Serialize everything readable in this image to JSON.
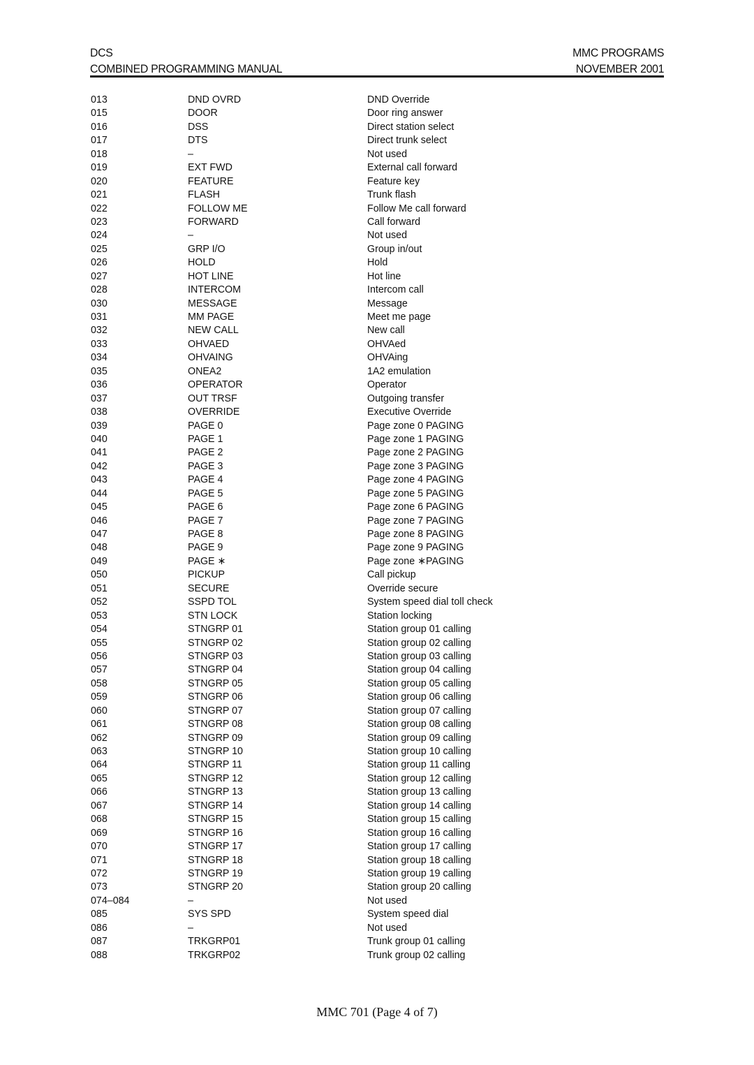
{
  "header": {
    "left_line1": "DCS",
    "left_line2": "COMBINED PROGRAMMING MANUAL",
    "right_line1": "MMC PROGRAMS",
    "right_line2": "NOVEMBER 2001"
  },
  "table": {
    "rows": [
      {
        "code": "013",
        "key": "DND OVRD",
        "desc": "DND Override"
      },
      {
        "code": "015",
        "key": "DOOR",
        "desc": "Door ring answer"
      },
      {
        "code": "016",
        "key": "DSS",
        "desc": "Direct station select"
      },
      {
        "code": "017",
        "key": "DTS",
        "desc": "Direct trunk select"
      },
      {
        "code": "018",
        "key": "–",
        "desc": "Not used"
      },
      {
        "code": "019",
        "key": "EXT FWD",
        "desc": "External call forward"
      },
      {
        "code": "020",
        "key": "FEATURE",
        "desc": "Feature key"
      },
      {
        "code": "021",
        "key": "FLASH",
        "desc": "Trunk flash"
      },
      {
        "code": "022",
        "key": "FOLLOW ME",
        "desc": "Follow Me call forward"
      },
      {
        "code": "023",
        "key": "FORWARD",
        "desc": "Call forward"
      },
      {
        "code": "024",
        "key": "–",
        "desc": "Not used"
      },
      {
        "code": "025",
        "key": "GRP I/O",
        "desc": "Group in/out"
      },
      {
        "code": "026",
        "key": "HOLD",
        "desc": "Hold"
      },
      {
        "code": "027",
        "key": "HOT LINE",
        "desc": "Hot line"
      },
      {
        "code": "028",
        "key": "INTERCOM",
        "desc": "Intercom call"
      },
      {
        "code": "030",
        "key": "MESSAGE",
        "desc": "Message"
      },
      {
        "code": "031",
        "key": "MM PAGE",
        "desc": "Meet me page"
      },
      {
        "code": "032",
        "key": "NEW CALL",
        "desc": "New call"
      },
      {
        "code": "033",
        "key": "OHVAED",
        "desc": "OHVAed"
      },
      {
        "code": "034",
        "key": "OHVAING",
        "desc": "OHVAing"
      },
      {
        "code": "035",
        "key": "ONEA2",
        "desc": "1A2 emulation"
      },
      {
        "code": "036",
        "key": "OPERATOR",
        "desc": "Operator"
      },
      {
        "code": "037",
        "key": "OUT TRSF",
        "desc": "Outgoing transfer"
      },
      {
        "code": "038",
        "key": "OVERRIDE",
        "desc": "Executive Override"
      },
      {
        "code": "039",
        "key": "PAGE 0",
        "desc": "Page zone 0 PAGING"
      },
      {
        "code": "040",
        "key": "PAGE 1",
        "desc": "Page zone 1 PAGING"
      },
      {
        "code": "041",
        "key": "PAGE 2",
        "desc": "Page zone 2 PAGING"
      },
      {
        "code": "042",
        "key": "PAGE 3",
        "desc": "Page zone 3 PAGING"
      },
      {
        "code": "043",
        "key": "PAGE 4",
        "desc": "Page zone 4 PAGING"
      },
      {
        "code": "044",
        "key": "PAGE 5",
        "desc": "Page zone 5 PAGING"
      },
      {
        "code": "045",
        "key": "PAGE 6",
        "desc": "Page zone 6 PAGING"
      },
      {
        "code": "046",
        "key": "PAGE 7",
        "desc": "Page zone 7 PAGING"
      },
      {
        "code": "047",
        "key": "PAGE 8",
        "desc": "Page zone 8 PAGING"
      },
      {
        "code": "048",
        "key": "PAGE 9",
        "desc": "Page zone 9 PAGING"
      },
      {
        "code": "049",
        "key": "PAGE ∗",
        "desc": "Page zone ∗PAGING"
      },
      {
        "code": "050",
        "key": "PICKUP",
        "desc": "Call pickup"
      },
      {
        "code": "051",
        "key": "SECURE",
        "desc": "Override secure"
      },
      {
        "code": "052",
        "key": "SSPD TOL",
        "desc": "System speed dial toll check"
      },
      {
        "code": "053",
        "key": "STN LOCK",
        "desc": "Station locking"
      },
      {
        "code": "054",
        "key": "STNGRP 01",
        "desc": "Station group 01 calling"
      },
      {
        "code": "055",
        "key": "STNGRP 02",
        "desc": "Station group 02 calling"
      },
      {
        "code": "056",
        "key": "STNGRP 03",
        "desc": "Station group 03 calling"
      },
      {
        "code": "057",
        "key": "STNGRP 04",
        "desc": "Station group 04 calling"
      },
      {
        "code": "058",
        "key": "STNGRP 05",
        "desc": "Station group 05 calling"
      },
      {
        "code": "059",
        "key": "STNGRP 06",
        "desc": "Station group 06 calling"
      },
      {
        "code": "060",
        "key": "STNGRP 07",
        "desc": "Station group 07 calling"
      },
      {
        "code": "061",
        "key": "STNGRP 08",
        "desc": "Station group 08 calling"
      },
      {
        "code": "062",
        "key": "STNGRP 09",
        "desc": "Station group 09 calling"
      },
      {
        "code": "063",
        "key": "STNGRP 10",
        "desc": "Station group 10 calling"
      },
      {
        "code": "064",
        "key": "STNGRP 11",
        "desc": "Station group 11 calling"
      },
      {
        "code": "065",
        "key": "STNGRP 12",
        "desc": "Station group 12 calling"
      },
      {
        "code": "066",
        "key": "STNGRP 13",
        "desc": "Station group 13 calling"
      },
      {
        "code": "067",
        "key": "STNGRP 14",
        "desc": "Station group 14 calling"
      },
      {
        "code": "068",
        "key": "STNGRP 15",
        "desc": "Station group 15 calling"
      },
      {
        "code": "069",
        "key": "STNGRP 16",
        "desc": "Station group 16 calling"
      },
      {
        "code": "070",
        "key": "STNGRP 17",
        "desc": "Station group 17 calling"
      },
      {
        "code": "071",
        "key": "STNGRP 18",
        "desc": "Station group 18 calling"
      },
      {
        "code": "072",
        "key": "STNGRP 19",
        "desc": "Station group 19 calling"
      },
      {
        "code": "073",
        "key": "STNGRP 20",
        "desc": "Station group 20 calling"
      },
      {
        "code": "074–084",
        "key": "–",
        "desc": "Not used"
      },
      {
        "code": "085",
        "key": "SYS SPD",
        "desc": "System speed dial"
      },
      {
        "code": "086",
        "key": "–",
        "desc": "Not used"
      },
      {
        "code": "087",
        "key": "TRKGRP01",
        "desc": "Trunk group 01 calling"
      },
      {
        "code": "088",
        "key": "TRKGRP02",
        "desc": "Trunk group 02 calling"
      }
    ]
  },
  "footer": {
    "page_label": "MMC 701 (Page 4 of 7)"
  }
}
